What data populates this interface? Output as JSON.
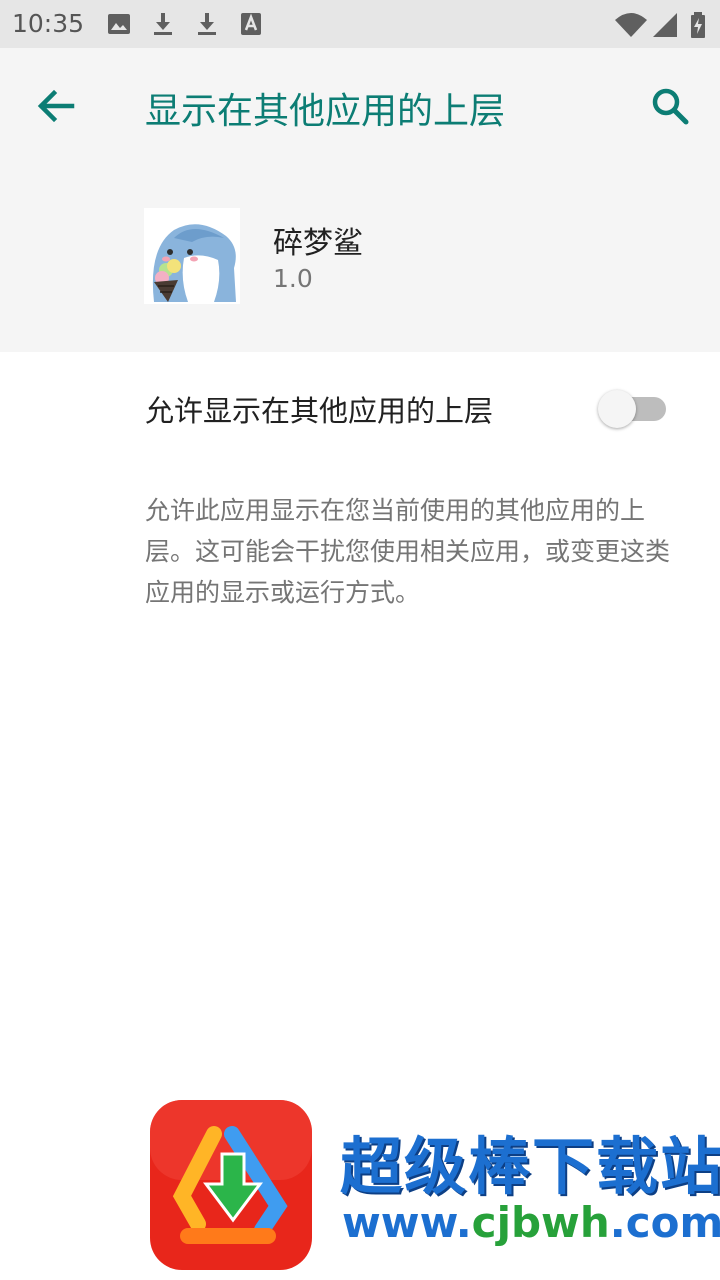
{
  "status_bar": {
    "time": "10:35",
    "left_icons": [
      "image-icon",
      "download-icon",
      "download-icon",
      "text-icon"
    ],
    "right_icons": [
      "wifi-icon",
      "signal-icon",
      "battery-icon"
    ]
  },
  "app_bar": {
    "title": "显示在其他应用的上层",
    "back_icon": "arrow-back-icon",
    "search_icon": "search-icon",
    "accent_color": "#0c7d74"
  },
  "app_info": {
    "name": "碎梦鲨",
    "version": "1.0"
  },
  "setting": {
    "label": "允许显示在其他应用的上层",
    "enabled": false
  },
  "description": "允许此应用显示在您当前使用的其他应用的上层。这可能会干扰您使用相关应用，或变更这类应用的显示或运行方式。",
  "watermark": {
    "title": "超级棒下载站",
    "url_prefix": "www.",
    "url_accent": "cjbwh",
    "url_suffix": ".com"
  }
}
